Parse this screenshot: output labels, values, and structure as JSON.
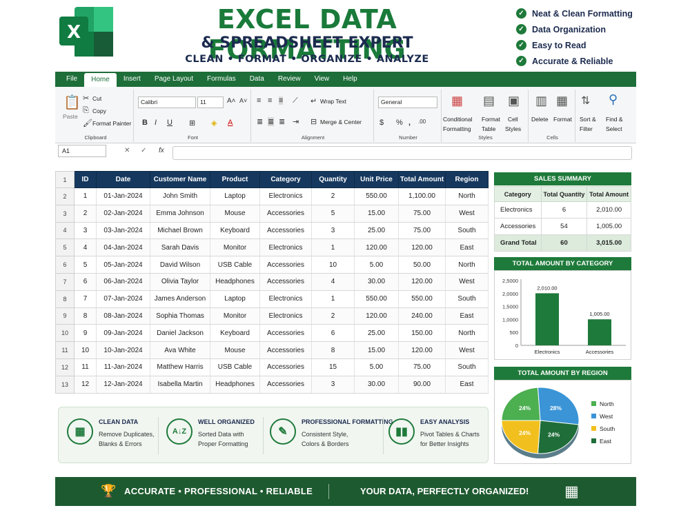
{
  "header": {
    "title": "EXCEL DATA FORMATTING",
    "subtitle": "& SPREADSHEET EXPERT",
    "tagline": "CLEAN • FORMAT • ORGANIZE • ANALYZE",
    "logo_letter": "X",
    "features": [
      "Neat & Clean Formatting",
      "Data Organization",
      "Easy to Read",
      "Accurate & Reliable"
    ]
  },
  "ribbon": {
    "tabs": [
      "File",
      "Home",
      "Insert",
      "Page Layout",
      "Formulas",
      "Data",
      "Review",
      "View",
      "Help"
    ],
    "active_tab": "Home",
    "clipboard": {
      "paste": "Paste",
      "cut": "Cut",
      "copy": "Copy",
      "format_painter": "Format Painter",
      "label": "Clipboard"
    },
    "font": {
      "name": "Calibri",
      "size": "11",
      "label": "Font"
    },
    "alignment": {
      "wrap": "Wrap Text",
      "merge": "Merge & Center",
      "label": "Alignment"
    },
    "number": {
      "format": "General",
      "label": "Number"
    },
    "styles": {
      "conditional": "Conditional",
      "formatting": "Formatting",
      "format_as": "Format",
      "table": "Table",
      "cell": "Cell",
      "styles_word": "Styles",
      "label": "Styles"
    },
    "cells": {
      "delete": "Delete",
      "format": "Format",
      "label": "Cells"
    },
    "editing": {
      "sort": "Sort &",
      "filter": "Filter",
      "find": "Find &",
      "select": "Select"
    }
  },
  "formula_bar": {
    "name_box": "A1",
    "fx": "fx"
  },
  "table": {
    "headers": [
      "ID",
      "Date",
      "Customer Name",
      "Product",
      "Category",
      "Quantity",
      "Unit Price",
      "Total Amount",
      "Region"
    ],
    "rows": [
      [
        "1",
        "01-Jan-2024",
        "John Smith",
        "Laptop",
        "Electronics",
        "2",
        "550.00",
        "1,100.00",
        "North"
      ],
      [
        "2",
        "02-Jan-2024",
        "Emma Johnson",
        "Mouse",
        "Accessories",
        "5",
        "15.00",
        "75.00",
        "West"
      ],
      [
        "3",
        "03-Jan-2024",
        "Michael Brown",
        "Keyboard",
        "Accessories",
        "3",
        "25.00",
        "75.00",
        "South"
      ],
      [
        "4",
        "04-Jan-2024",
        "Sarah Davis",
        "Monitor",
        "Electronics",
        "1",
        "120.00",
        "120.00",
        "East"
      ],
      [
        "5",
        "05-Jan-2024",
        "David Wilson",
        "USB Cable",
        "Accessories",
        "10",
        "5.00",
        "50.00",
        "North"
      ],
      [
        "6",
        "06-Jan-2024",
        "Olivia Taylor",
        "Headphones",
        "Accessories",
        "4",
        "30.00",
        "120.00",
        "West"
      ],
      [
        "7",
        "07-Jan-2024",
        "James Anderson",
        "Laptop",
        "Electronics",
        "1",
        "550.00",
        "550.00",
        "South"
      ],
      [
        "8",
        "08-Jan-2024",
        "Sophia Thomas",
        "Monitor",
        "Electronics",
        "2",
        "120.00",
        "240.00",
        "East"
      ],
      [
        "9",
        "09-Jan-2024",
        "Daniel Jackson",
        "Keyboard",
        "Accessories",
        "6",
        "25.00",
        "150.00",
        "North"
      ],
      [
        "10",
        "10-Jan-2024",
        "Ava White",
        "Mouse",
        "Accessories",
        "8",
        "15.00",
        "120.00",
        "West"
      ],
      [
        "11",
        "11-Jan-2024",
        "Matthew Harris",
        "USB Cable",
        "Accessories",
        "15",
        "5.00",
        "75.00",
        "South"
      ],
      [
        "12",
        "12-Jan-2024",
        "Isabella Martin",
        "Headphones",
        "Accessories",
        "3",
        "30.00",
        "90.00",
        "East"
      ]
    ]
  },
  "summary": {
    "title": "SALES SUMMARY",
    "headers": [
      "Category",
      "Total Quantity",
      "Total Amount"
    ],
    "rows": [
      [
        "Electronics",
        "6",
        "2,010.00"
      ],
      [
        "Accessories",
        "54",
        "1,005.00"
      ]
    ],
    "total": [
      "Grand Total",
      "60",
      "3,015.00"
    ]
  },
  "chart_data": [
    {
      "type": "bar",
      "title": "TOTAL AMOUNT BY CATEGORY",
      "categories": [
        "Electronics",
        "Accessories"
      ],
      "values": [
        2010,
        1005
      ],
      "data_labels": [
        "2,010.00",
        "1,005.00"
      ],
      "ylim": [
        0,
        2500
      ],
      "yticks": [
        0,
        500,
        1000,
        1500,
        2000,
        2500
      ],
      "ytick_labels": [
        "0",
        "500",
        "1,0000",
        "1,5000",
        "2,0000",
        "2,5000"
      ],
      "color": "#1e7a3a"
    },
    {
      "type": "pie",
      "title": "TOTAL AMOUNT BY REGION",
      "categories": [
        "North",
        "West",
        "South",
        "East"
      ],
      "values": [
        24,
        28,
        24,
        24
      ],
      "labels": [
        "24%",
        "28%",
        "24%",
        "24%"
      ],
      "colors": [
        "#4caf50",
        "#3a94d6",
        "#f2c01e",
        "#1f6e3a"
      ],
      "legend": "right"
    }
  ],
  "strip": [
    {
      "title": "CLEAN DATA",
      "desc1": "Remove Duplicates,",
      "desc2": "Blanks & Errors",
      "icon": "grid-icon"
    },
    {
      "title": "WELL ORGANIZED",
      "desc1": "Sorted Data with",
      "desc2": "Proper Formatting",
      "icon": "sort-az-icon"
    },
    {
      "title": "PROFESSIONAL FORMATTING",
      "desc1": "Consistent Style,",
      "desc2": "Colors & Borders",
      "icon": "brush-icon"
    },
    {
      "title": "EASY ANALYSIS",
      "desc1": "Pivot Tables & Charts",
      "desc2": "for Better Insights",
      "icon": "bar-chart-icon"
    }
  ],
  "footer": {
    "left": "ACCURATE • PROFESSIONAL • RELIABLE",
    "right": "YOUR DATA, PERFECTLY ORGANIZED!"
  }
}
